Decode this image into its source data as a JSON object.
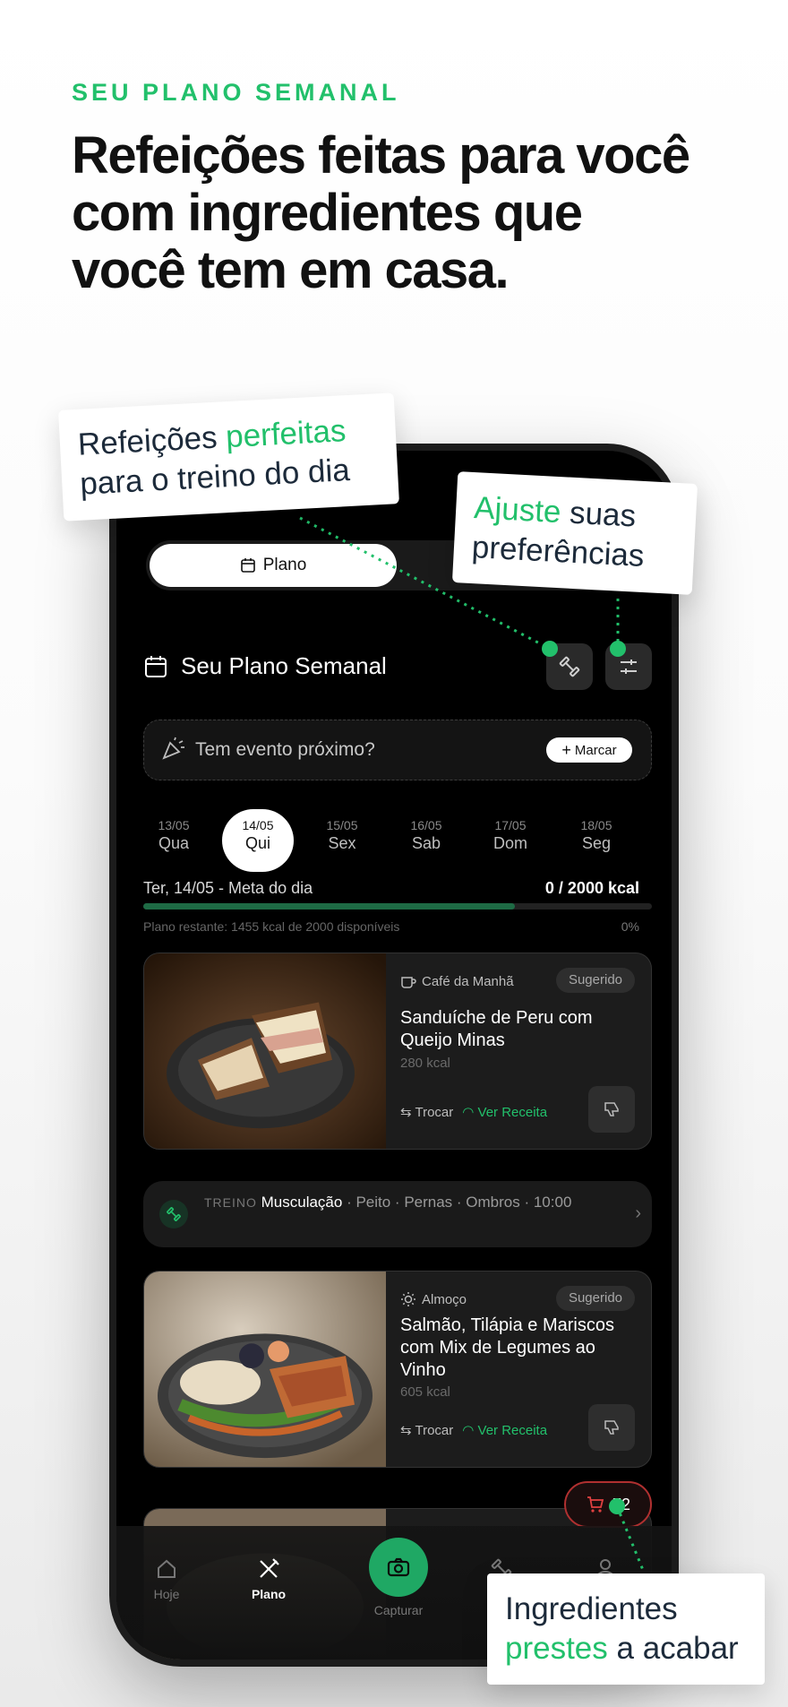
{
  "header": {
    "eyebrow": "SEU PLANO SEMANAL",
    "headline": "Refeições feitas para você com ingredientes que você tem em casa."
  },
  "callouts": {
    "c1": {
      "pre": "Refeições ",
      "hl": "perfeitas",
      "post": " para o treino do dia"
    },
    "c2": {
      "hl": "Ajuste",
      "post": " suas preferências"
    },
    "c3": {
      "pre": "Ingredientes ",
      "hl": "prestes",
      "post": " a acabar"
    }
  },
  "app": {
    "segment_active": "Plano",
    "plan_title": "Seu Plano Semanal",
    "event": {
      "text": "Tem evento próximo?",
      "button": "Marcar"
    },
    "days": [
      {
        "date": "13/05",
        "day": "Qua"
      },
      {
        "date": "14/05",
        "day": "Qui"
      },
      {
        "date": "15/05",
        "day": "Sex"
      },
      {
        "date": "16/05",
        "day": "Sab"
      },
      {
        "date": "17/05",
        "day": "Dom"
      },
      {
        "date": "18/05",
        "day": "Seg"
      }
    ],
    "selected_day_index": 1,
    "goal": {
      "label": "Ter, 14/05 - Meta do dia",
      "value": "0 / 2000 kcal",
      "progress": 0.73,
      "remaining": "Plano restante: 1455 kcal de 2000 disponíveis",
      "percent": "0%"
    },
    "meals": [
      {
        "category": "Café da Manhã",
        "badge": "Sugerido",
        "name": "Sanduíche de Peru com Queijo Minas",
        "kcal": "280 kcal",
        "swap": "Trocar",
        "recipe": "Ver Receita"
      },
      {
        "category": "Almoço",
        "badge": "Sugerido",
        "name": "Salmão, Tilápia e Mariscos com Mix de Legumes ao Vinho",
        "kcal": "605 kcal",
        "swap": "Trocar",
        "recipe": "Ver Receita"
      }
    ],
    "treino": {
      "label": "TREINO",
      "type": "Musculação",
      "details": "· Peito · Pernas · Ombros · 10:00"
    },
    "cart_count": "72",
    "nav": {
      "hoje": "Hoje",
      "plano": "Plano",
      "capturar": "Capturar",
      "treino": "Tr",
      "perfil": ""
    }
  },
  "colors": {
    "accent": "#22c06b",
    "cart_border": "#b03030"
  }
}
